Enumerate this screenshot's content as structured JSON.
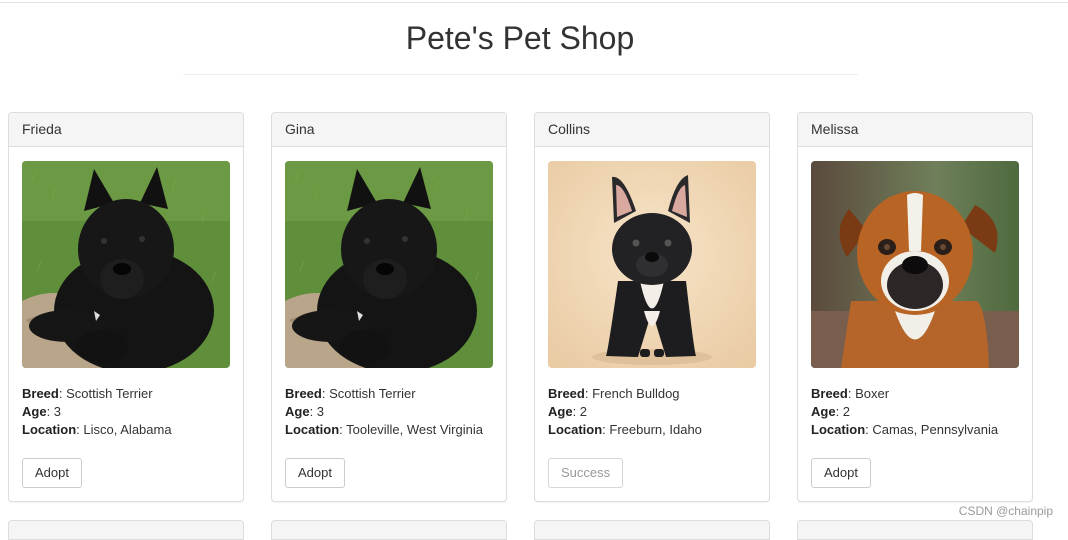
{
  "page": {
    "title": "Pete's Pet Shop"
  },
  "labels": {
    "breed": "Breed",
    "age": "Age",
    "location": "Location"
  },
  "pets": [
    {
      "name": "Frieda",
      "breed": "Scottish Terrier",
      "age": "3",
      "location": "Lisco, Alabama",
      "button": "Adopt",
      "photo": "scottish-terrier-photo"
    },
    {
      "name": "Gina",
      "breed": "Scottish Terrier",
      "age": "3",
      "location": "Tooleville, West Virginia",
      "button": "Adopt",
      "photo": "scottish-terrier-photo"
    },
    {
      "name": "Collins",
      "breed": "French Bulldog",
      "age": "2",
      "location": "Freeburn, Idaho",
      "button": "Success",
      "photo": "french-bulldog-photo"
    },
    {
      "name": "Melissa",
      "breed": "Boxer",
      "age": "2",
      "location": "Camas, Pennsylvania",
      "button": "Adopt",
      "photo": "boxer-photo"
    }
  ],
  "watermark": "CSDN @chainpip",
  "colors": {
    "panel_heading_bg": "#f5f5f5",
    "panel_border": "#dddddd",
    "text": "#333333",
    "disabled_text": "#999999"
  }
}
